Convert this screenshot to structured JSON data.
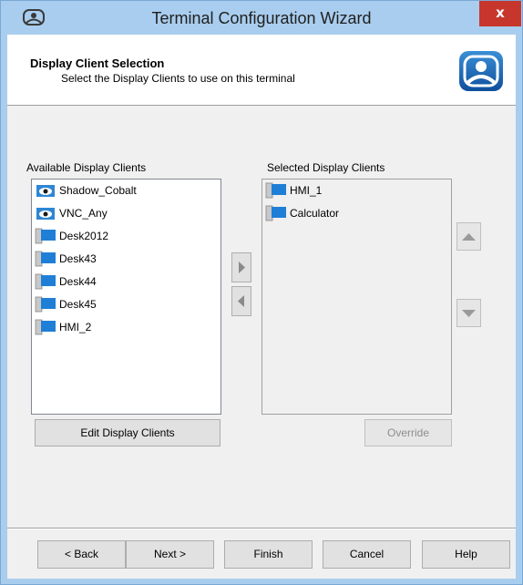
{
  "window": {
    "title": "Terminal Configuration Wizard",
    "close_label": "x"
  },
  "header": {
    "title": "Display Client Selection",
    "subtitle": "Select the Display Clients to use on this terminal"
  },
  "available": {
    "label": "Available Display Clients",
    "items": [
      {
        "label": "Shadow_Cobalt",
        "icon": "eye-display-icon"
      },
      {
        "label": "VNC_Any",
        "icon": "eye-display-icon"
      },
      {
        "label": "Desk2012",
        "icon": "display-client-icon"
      },
      {
        "label": "Desk43",
        "icon": "display-client-icon"
      },
      {
        "label": "Desk44",
        "icon": "display-client-icon"
      },
      {
        "label": "Desk45",
        "icon": "display-client-icon"
      },
      {
        "label": "HMI_2",
        "icon": "display-client-icon"
      }
    ],
    "edit_button": "Edit Display Clients"
  },
  "selected": {
    "label": "Selected Display Clients",
    "items": [
      {
        "label": "HMI_1",
        "icon": "display-client-icon"
      },
      {
        "label": "Calculator",
        "icon": "display-client-icon"
      }
    ],
    "override_button": "Override"
  },
  "footer": {
    "back": "< Back",
    "next": "Next >",
    "finish": "Finish",
    "cancel": "Cancel",
    "help": "Help"
  }
}
